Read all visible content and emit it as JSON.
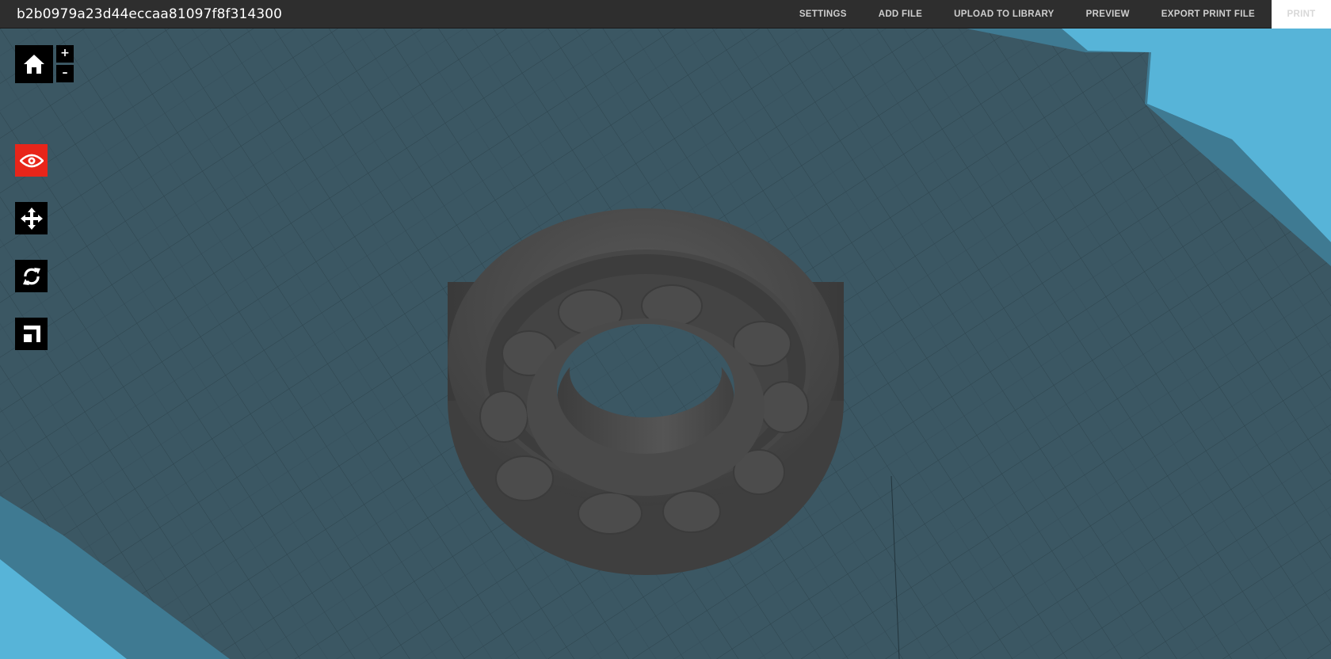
{
  "header": {
    "file_title": "b2b0979a23d44eccaa81097f8f314300",
    "nav": {
      "settings": "SETTINGS",
      "add_file": "ADD FILE",
      "upload_to_library": "UPLOAD TO LIBRARY",
      "preview": "PREVIEW",
      "export_print_file": "EXPORT PRINT FILE",
      "print": "PRINT"
    }
  },
  "view_controls": {
    "home_icon": "home-icon",
    "zoom_in_label": "+",
    "zoom_out_label": "–"
  },
  "tools": [
    {
      "name": "view",
      "icon": "eye-icon",
      "active": true
    },
    {
      "name": "move",
      "icon": "move-arrows-icon",
      "active": false
    },
    {
      "name": "rotate",
      "icon": "rotate-icon",
      "active": false
    },
    {
      "name": "scale",
      "icon": "scale-icon",
      "active": false
    }
  ],
  "colors": {
    "top_bar": "#2e2e2e",
    "build_plate": "#3b5763",
    "plate_edge": "#57b4d8",
    "model": "#4a4a4a",
    "active_tool": "#e8251a",
    "tool_bg": "#000000"
  }
}
